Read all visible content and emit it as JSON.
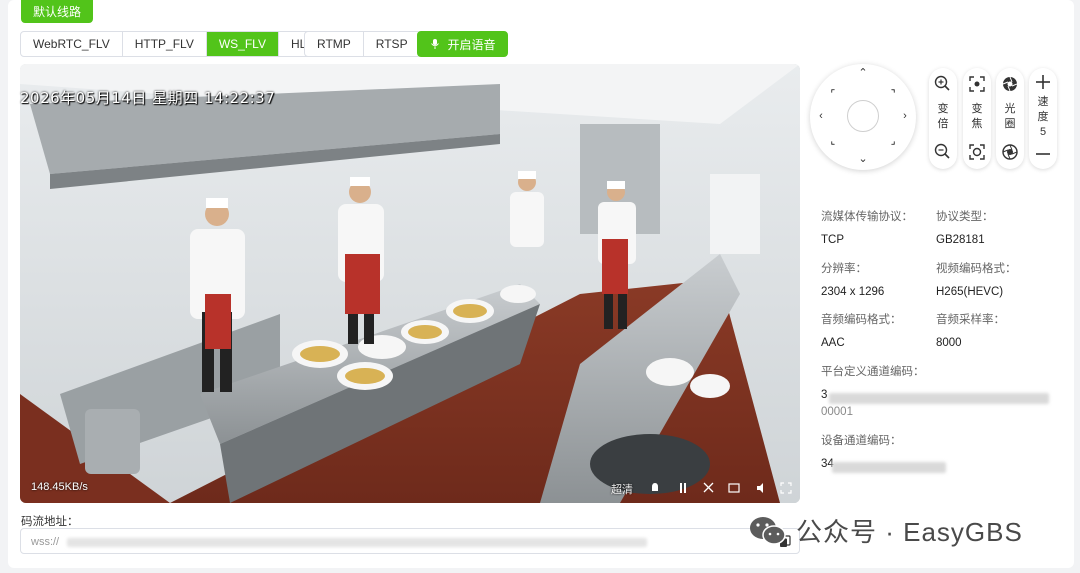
{
  "top_button": "默认线路",
  "protocol_tabs": [
    "WebRTC_FLV",
    "HTTP_FLV",
    "WS_FLV",
    "HLS"
  ],
  "protocol_tabs_active": "WS_FLV",
  "extra_tabs": [
    "RTMP",
    "RTSP"
  ],
  "voice_button": "开启语音",
  "video": {
    "osd_time": "2026年05月14日  星期四  14:22:37",
    "bitrate": "148.45KB/s",
    "resolution_toggle": "超清"
  },
  "ptz": {
    "zoom_label": "变倍",
    "focus_label": "变焦",
    "iris_label": "光圈",
    "speed_label": "速度",
    "speed_value": "5"
  },
  "info": {
    "stream_protocol_label": "流媒体传输协议：",
    "stream_protocol_value": "TCP",
    "protocol_type_label": "协议类型：",
    "protocol_type_value": "GB28181",
    "resolution_label": "分辨率：",
    "resolution_value": "2304 x 1296",
    "video_codec_label": "视频编码格式：",
    "video_codec_value": "H265(HEVC)",
    "audio_codec_label": "音频编码格式：",
    "audio_codec_value": "AAC",
    "audio_sample_label": "音频采样率：",
    "audio_sample_value": "8000",
    "platform_channel_label": "平台定义通道编码：",
    "platform_channel_value_a": "3",
    "platform_channel_value_b": "00001",
    "device_channel_label": "设备通道编码：",
    "device_channel_value": "34"
  },
  "address": {
    "label": "码流地址：",
    "prefix": "wss://"
  },
  "watermark": "公众号 · EasyGBS",
  "colors": {
    "accent": "#52c41a"
  }
}
